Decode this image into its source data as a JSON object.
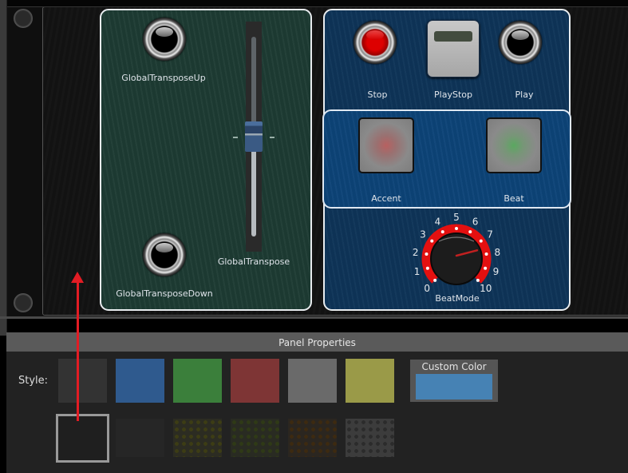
{
  "green_panel": {
    "transpose_up": {
      "label": "GlobalTransposeUp",
      "state": "off"
    },
    "transpose_down": {
      "label": "GlobalTransposeDown",
      "state": "off"
    },
    "transpose_slider": {
      "label": "GlobalTranspose",
      "value_fraction": 0.5
    }
  },
  "blue_panel": {
    "stop": {
      "label": "Stop",
      "state": "on",
      "led_color": "#dd0000"
    },
    "playstop": {
      "label": "PlayStop"
    },
    "play": {
      "label": "Play",
      "state": "off"
    },
    "accent": {
      "label": "Accent",
      "led_color": "#b86060"
    },
    "beat": {
      "label": "Beat",
      "led_color": "#5aa860"
    },
    "beatmode": {
      "label": "BeatMode",
      "scale": [
        "0",
        "1",
        "2",
        "3",
        "4",
        "5",
        "6",
        "7",
        "8",
        "9",
        "10"
      ],
      "value": 7.5,
      "min": 0,
      "max": 10,
      "ring_color": "#e31010"
    }
  },
  "properties": {
    "title": "Panel Properties",
    "style_label": "Style:",
    "color_swatches": [
      {
        "name": "dark",
        "color": "#333333"
      },
      {
        "name": "blue",
        "color": "#2f5a8e"
      },
      {
        "name": "green",
        "color": "#3b7f3b"
      },
      {
        "name": "red",
        "color": "#7e3535"
      },
      {
        "name": "gray",
        "color": "#6a6a6a"
      },
      {
        "name": "olive",
        "color": "#9a9a48"
      }
    ],
    "texture_swatches": [
      {
        "name": "black-grunge",
        "selected": true
      },
      {
        "name": "dark-grunge",
        "selected": false
      },
      {
        "name": "olive-dots",
        "selected": false
      },
      {
        "name": "green-dots",
        "selected": false
      },
      {
        "name": "brown-dots",
        "selected": false
      },
      {
        "name": "gray-perforated",
        "selected": false
      }
    ],
    "custom_color": {
      "label": "Custom Color",
      "value": "#4682b4"
    }
  },
  "annotation": {
    "arrow_color": "#e21c24"
  }
}
